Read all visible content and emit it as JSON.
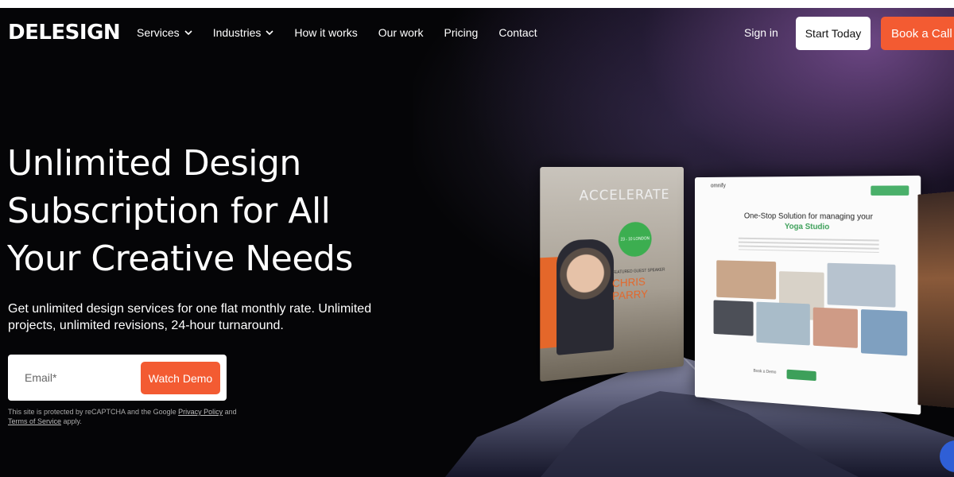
{
  "brand": {
    "logo": "DELESIGN",
    "accent": "#f35b32"
  },
  "nav": {
    "links": [
      "Services",
      "Industries",
      "How it works",
      "Our work",
      "Pricing",
      "Contact"
    ],
    "signin": "Sign in",
    "start_today": "Start Today",
    "book_call": "Book a Call"
  },
  "hero": {
    "title_lines": [
      "Unlimited Design",
      "Subscription for All",
      "Your Creative Needs"
    ],
    "subtitle": "Get unlimited design services for one flat monthly rate. Unlimited projects, unlimited revisions, 24-hour turnaround.",
    "email_placeholder": "Email*",
    "demo_button": "Watch Demo",
    "recaptcha_prefix": "This site is protected by reCAPTCHA and the Google ",
    "privacy_link": "Privacy Policy",
    "recaptcha_and": " and ",
    "terms_link": "Terms of Service",
    "recaptcha_suffix": " apply."
  },
  "mockups": {
    "card1": {
      "heading": "ACCELERATE",
      "badge": "23 - 10 LONDON",
      "speaker_label": "FEATURED GUEST SPEAKER",
      "speaker_name_1": "CHRIS",
      "speaker_name_2": "PARRY"
    },
    "card2": {
      "logo": "omnify",
      "title": "One-Stop Solution for managing your",
      "title_highlight": "Yoga Studio",
      "button": "Try for Free",
      "link": "Book a Demo"
    }
  }
}
